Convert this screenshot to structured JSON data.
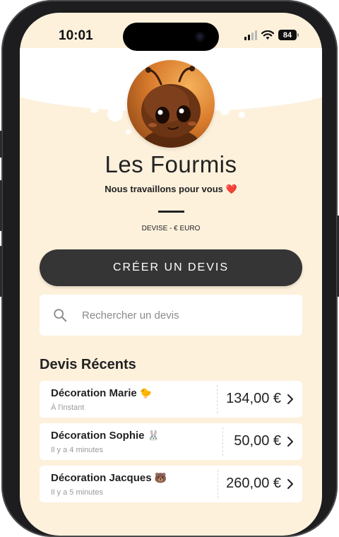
{
  "status_bar": {
    "time": "10:01",
    "battery": "84"
  },
  "brand": {
    "name": "Les Fourmis",
    "tagline": "Nous travaillons pour vous ❤️"
  },
  "currency": "DEVISE - € EURO",
  "cta": {
    "label": "CRÉER UN DEVIS"
  },
  "search": {
    "placeholder": "Rechercher un devis"
  },
  "recent": {
    "title": "Devis Récents",
    "items": [
      {
        "name": "Décoration Marie",
        "emoji": "🐤",
        "time": "À l'instant",
        "amount": "134,00 €"
      },
      {
        "name": "Décoration Sophie",
        "emoji": "🐰",
        "time": "Il y a 4 minutes",
        "amount": "50,00 €"
      },
      {
        "name": "Décoration Jacques",
        "emoji": "🐻",
        "time": "Il y a 5 minutes",
        "amount": "260,00 €"
      }
    ]
  },
  "colors": {
    "background": "#fdf1dc",
    "button": "#353535",
    "card": "#ffffff",
    "text": "#222222"
  }
}
